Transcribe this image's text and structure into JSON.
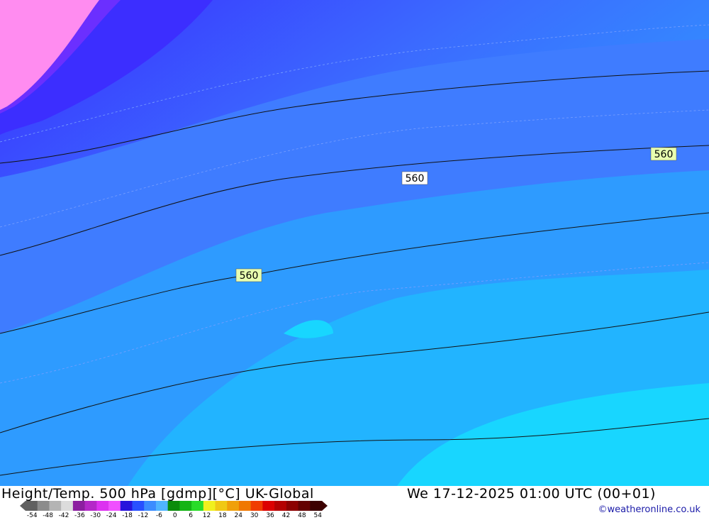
{
  "map": {
    "contour_labels": [
      "560",
      "560",
      "560"
    ],
    "colors": {
      "pink": "#ff8cf0",
      "violet": "#6b2fff",
      "blue_dark": "#3f3aff",
      "blue_mid": "#3b78ff",
      "blue_light": "#2fa3ff",
      "cyan": "#1ec9ff",
      "cyan_light": "#12e4ff",
      "contour": "#111111",
      "label_bg": "#e8ffb0"
    },
    "regions_icon": "temperature-field"
  },
  "footer": {
    "title": "Height/Temp. 500 hPa [gdmp][°C] UK-Global",
    "datetime": "We 17-12-2025 01:00 UTC (00+01)",
    "credit": "©weatheronline.co.uk",
    "scale_ticks": [
      "-54",
      "-48",
      "-42",
      "-36",
      "-30",
      "-24",
      "-18",
      "-12",
      "-6",
      "0",
      "6",
      "12",
      "18",
      "24",
      "30",
      "36",
      "42",
      "48",
      "54"
    ],
    "scale_colors": [
      "#606060",
      "#8c8c8c",
      "#b4b4b4",
      "#dcdcdc",
      "#8c1ea0",
      "#b428c8",
      "#dc32f0",
      "#f050ff",
      "#2814dc",
      "#2850ff",
      "#3c8cff",
      "#50b4ff",
      "#0a8c0a",
      "#14b414",
      "#28dc28",
      "#f0f01e",
      "#f0c814",
      "#f0a00a",
      "#f07800",
      "#f03c00",
      "#dc0000",
      "#b40000",
      "#8c0000",
      "#640000",
      "#3c0000"
    ]
  }
}
